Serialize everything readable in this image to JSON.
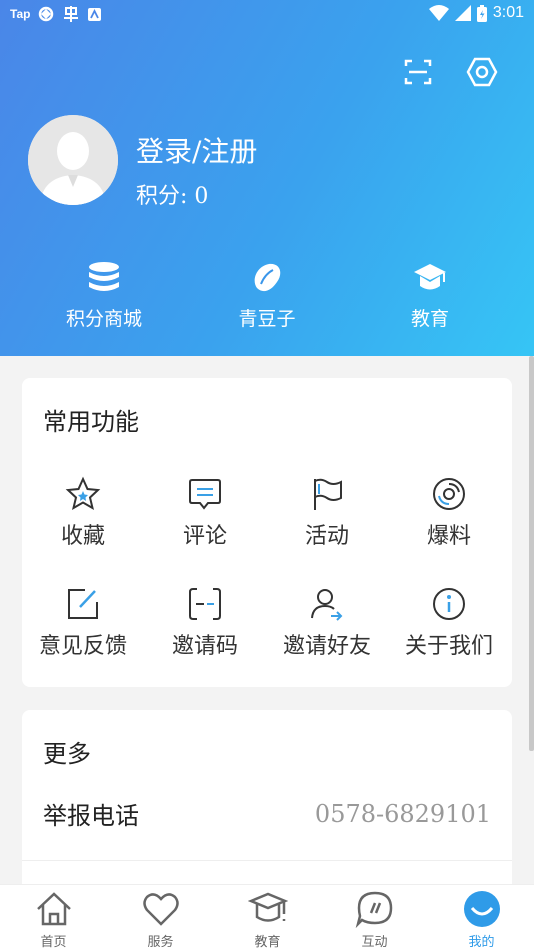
{
  "status_bar": {
    "app1": "Tap",
    "time": "3:01"
  },
  "profile": {
    "login_label": "登录/注册",
    "points_label": "积分: 0"
  },
  "quick_links": [
    {
      "label": "积分商城",
      "icon": "database-icon"
    },
    {
      "label": "青豆子",
      "icon": "bean-icon"
    },
    {
      "label": "教育",
      "icon": "graduation-cap-icon"
    }
  ],
  "common": {
    "title": "常用功能",
    "items": [
      {
        "label": "收藏",
        "icon": "star-icon"
      },
      {
        "label": "评论",
        "icon": "comment-icon"
      },
      {
        "label": "活动",
        "icon": "flag-icon"
      },
      {
        "label": "爆料",
        "icon": "disc-icon"
      },
      {
        "label": "意见反馈",
        "icon": "edit-icon"
      },
      {
        "label": "邀请码",
        "icon": "code-icon"
      },
      {
        "label": "邀请好友",
        "icon": "invite-user-icon"
      },
      {
        "label": "关于我们",
        "icon": "info-icon"
      }
    ]
  },
  "more": {
    "title": "更多",
    "report_label": "举报电话",
    "report_phone": "0578-6829101"
  },
  "tabs": [
    {
      "label": "首页",
      "icon": "home-icon"
    },
    {
      "label": "服务",
      "icon": "heart-icon"
    },
    {
      "label": "教育",
      "icon": "graduation-cap-icon"
    },
    {
      "label": "互动",
      "icon": "chat-icon"
    },
    {
      "label": "我的",
      "icon": "smile-icon",
      "active": true
    }
  ],
  "colors": {
    "accent": "#2f9be8",
    "header_start": "#4a86e8",
    "header_end": "#36c5f5"
  }
}
